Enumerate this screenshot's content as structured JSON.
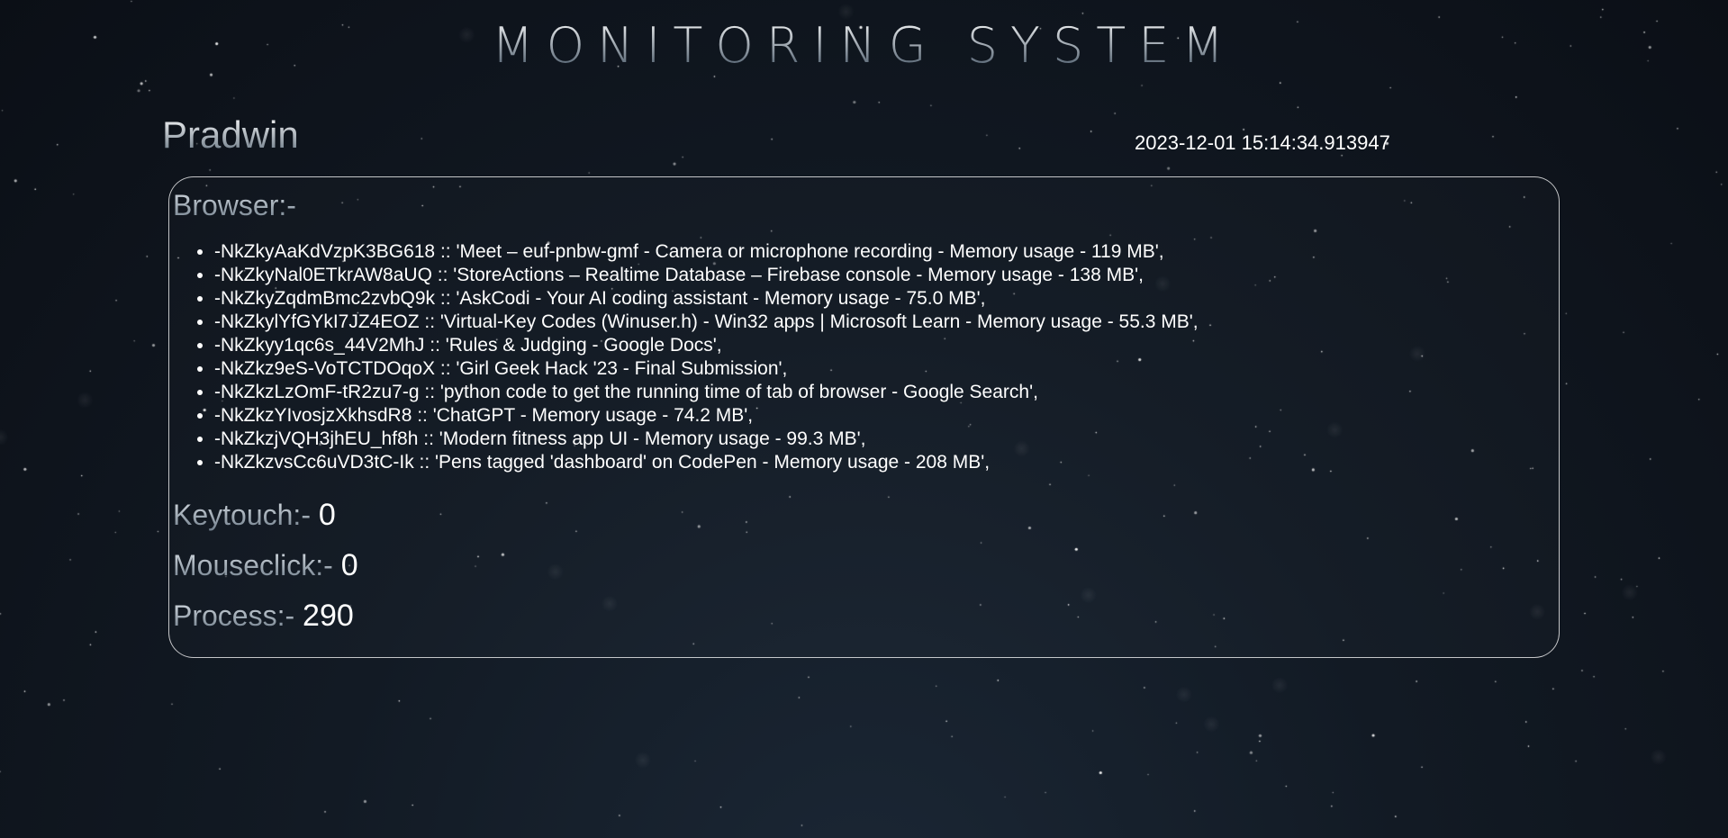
{
  "header": {
    "title": "MONITORING SYSTEM"
  },
  "user": {
    "name": "Pradwin",
    "timestamp": "2023-12-01 15:14:34.913947"
  },
  "panel": {
    "browser_label": "Browser:-",
    "tabs": [
      "-NkZkyAaKdVzpK3BG618 :: 'Meet – euf-pnbw-gmf - Camera or microphone recording - Memory usage - 119 MB',",
      "-NkZkyNal0ETkrAW8aUQ :: 'StoreActions – Realtime Database – Firebase console - Memory usage - 138 MB',",
      "-NkZkyZqdmBmc2zvbQ9k :: 'AskCodi - Your AI coding assistant - Memory usage - 75.0 MB',",
      "-NkZkylYfGYkI7JZ4EOZ :: 'Virtual-Key Codes (Winuser.h) - Win32 apps | Microsoft Learn - Memory usage - 55.3 MB',",
      "-NkZkyy1qc6s_44V2MhJ :: 'Rules & Judging - Google Docs',",
      "-NkZkz9eS-VoTCTDOqoX :: 'Girl Geek Hack '23 - Final Submission',",
      "-NkZkzLzOmF-tR2zu7-g :: 'python code to get the running time of tab of browser - Google Search',",
      "-NkZkzYIvosjzXkhsdR8 :: 'ChatGPT - Memory usage - 74.2 MB',",
      "-NkZkzjVQH3jhEU_hf8h :: 'Modern fitness app UI - Memory usage - 99.3 MB',",
      "-NkZkzvsCc6uVD3tC-Ik :: 'Pens tagged 'dashboard' on CodePen - Memory usage - 208 MB',"
    ],
    "keytouch_label": "Keytouch:-",
    "keytouch_value": "0",
    "mouseclick_label": "Mouseclick:-",
    "mouseclick_value": "0",
    "process_label": "Process:-",
    "process_value": "290"
  },
  "colors": {
    "background": "#121a24",
    "text": "#ffffff",
    "panel_border": "#d0d4d8"
  }
}
